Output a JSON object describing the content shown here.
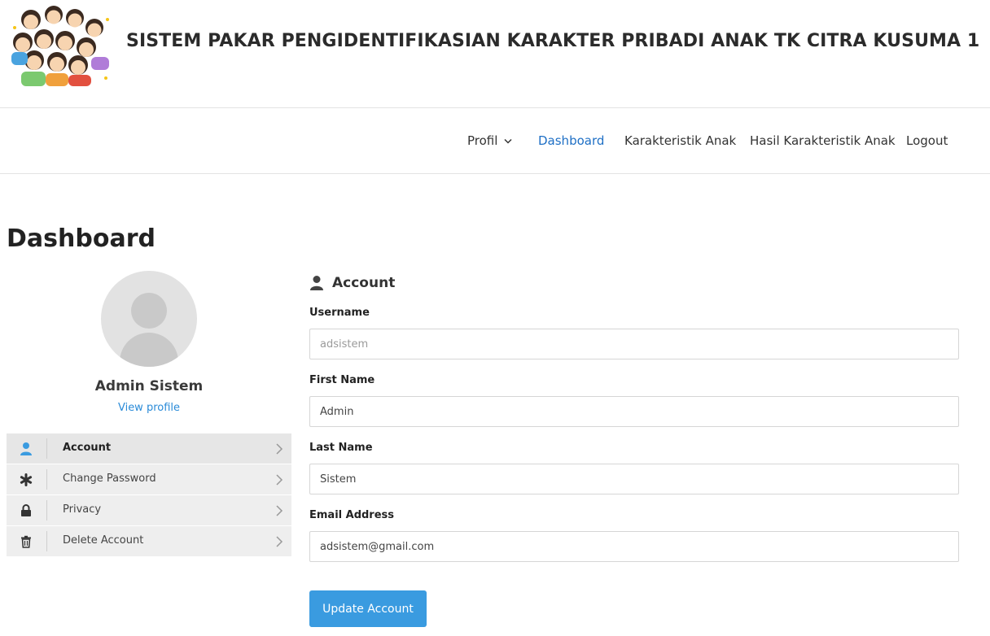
{
  "header": {
    "title": "SISTEM PAKAR PENGIDENTIFIKASIAN KARAKTER PRIBADI ANAK TK CITRA KUSUMA 1"
  },
  "nav": {
    "items": [
      {
        "label": "Profil",
        "has_dropdown": true
      },
      {
        "label": "Dashboard",
        "active": true
      },
      {
        "label": "Karakteristik Anak"
      },
      {
        "label": "Hasil Karakteristik Anak"
      },
      {
        "label": "Logout"
      }
    ]
  },
  "page": {
    "title": "Dashboard"
  },
  "profile": {
    "name": "Admin Sistem",
    "view_profile_link": "View profile"
  },
  "side_menu": {
    "items": [
      {
        "label": "Account",
        "icon": "user-icon",
        "active": true
      },
      {
        "label": "Change Password",
        "icon": "asterisk-icon"
      },
      {
        "label": "Privacy",
        "icon": "lock-icon"
      },
      {
        "label": "Delete Account",
        "icon": "trash-icon"
      }
    ]
  },
  "form": {
    "heading": "Account",
    "fields": [
      {
        "label": "Username",
        "value": "adsistem",
        "readonly": true
      },
      {
        "label": "First Name",
        "value": "Admin"
      },
      {
        "label": "Last Name",
        "value": "Sistem"
      },
      {
        "label": "Email Address",
        "value": "adsistem@gmail.com"
      }
    ],
    "submit_label": "Update Account"
  },
  "colors": {
    "accent": "#1e6fc5",
    "button": "#3a9be0",
    "link": "#2a8bd8",
    "menu_bg": "#eeeeee"
  }
}
